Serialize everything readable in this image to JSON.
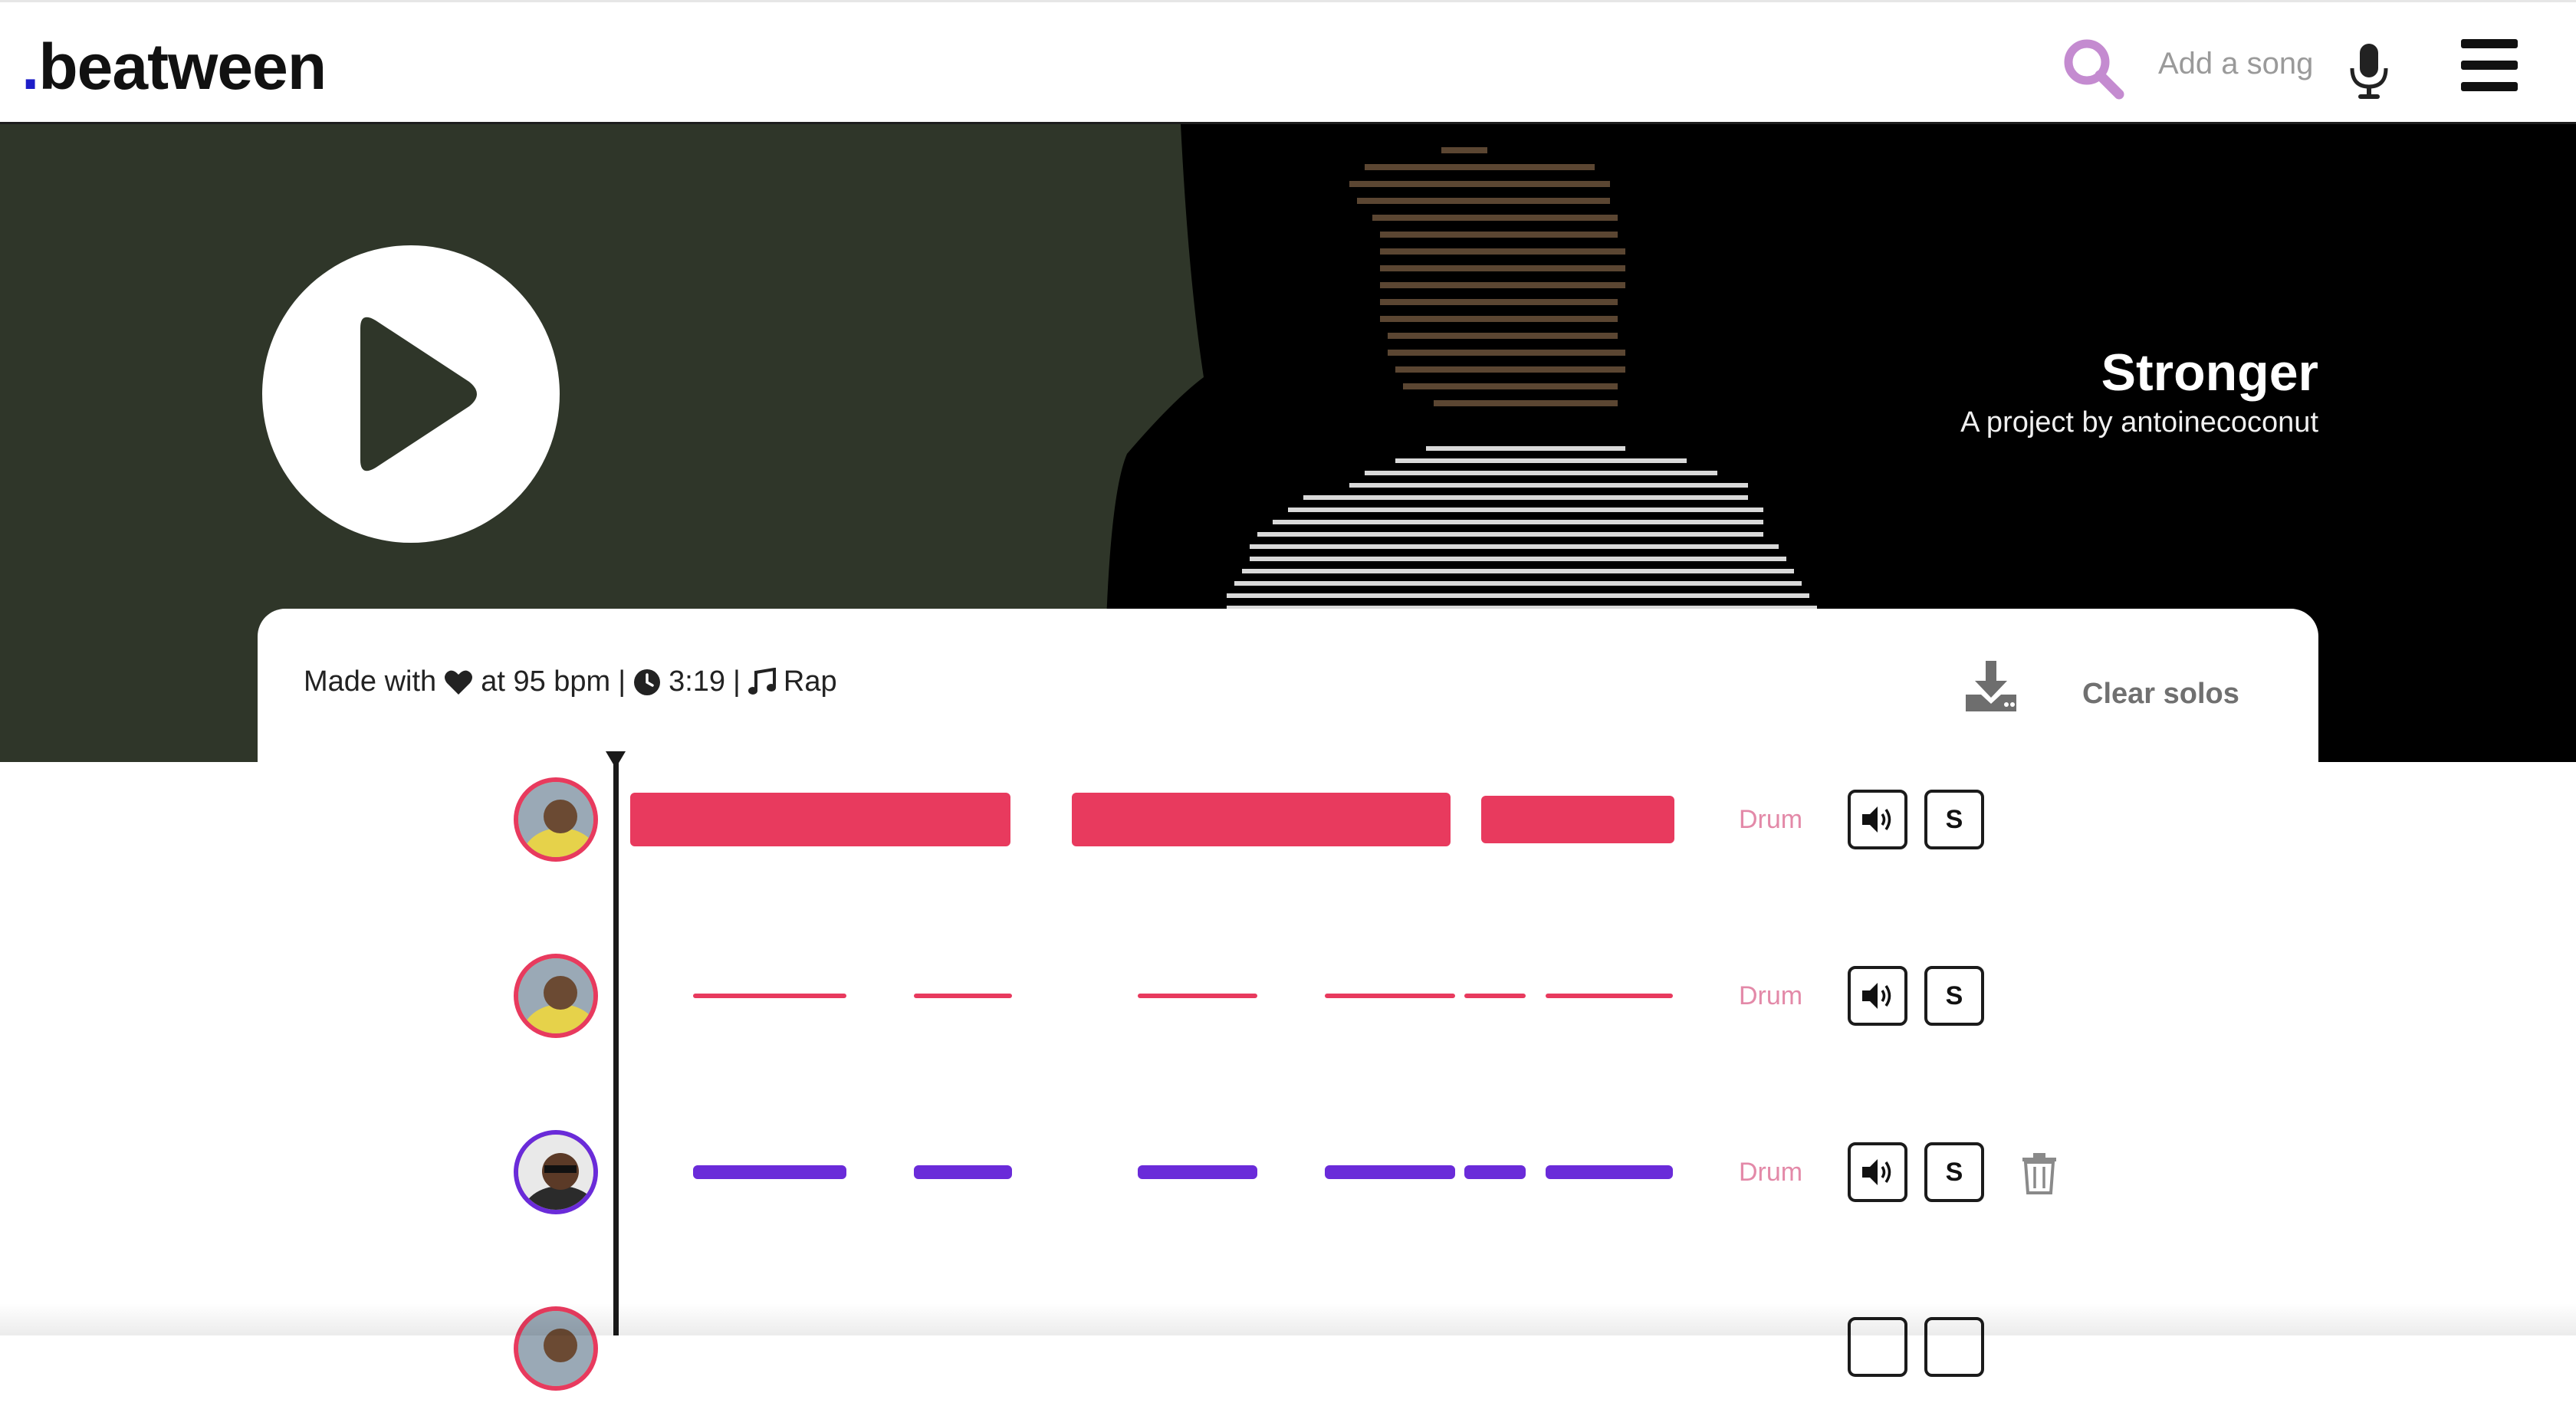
{
  "app": {
    "logo_dot": ".",
    "logo_text": "beatween",
    "accent": "#1d1dc8"
  },
  "nav": {
    "search_icon": "search-icon",
    "search_color": "#c48bd0",
    "add_song_label": "Add a song",
    "mic_icon": "microphone-icon",
    "menu_icon": "hamburger-menu-icon"
  },
  "hero": {
    "title": "Stronger",
    "subtitle": "A project by antoinecoconut",
    "left_color": "#2f3629",
    "play_icon": "play-icon"
  },
  "meta": {
    "made_with": "Made with",
    "heart_icon": "heart-icon",
    "bpm_text": "at 95 bpm",
    "sep1": "|",
    "clock_icon": "clock-icon",
    "duration": "3:19",
    "sep2": "|",
    "music_icon": "music-note-icon",
    "genre": "Rap"
  },
  "actions": {
    "download_icon": "download-icon",
    "clear_solos_label": "Clear solos"
  },
  "tracks": [
    {
      "instrument": "Drum",
      "wave_color": "#e83a5e",
      "avatar_border": "#e83a5e",
      "mute_icon": "speaker-icon",
      "solo_label": "S",
      "deletable": false
    },
    {
      "instrument": "Drum",
      "wave_color": "#e83a5e",
      "avatar_border": "#e83a5e",
      "mute_icon": "speaker-icon",
      "solo_label": "S",
      "deletable": false
    },
    {
      "instrument": "Drum",
      "wave_color": "#6a2bd9",
      "avatar_border": "#6a2bd9",
      "mute_icon": "speaker-icon",
      "solo_label": "S",
      "deletable": true
    },
    {
      "instrument": "",
      "wave_color": "#e83a5e",
      "avatar_border": "#e83a5e",
      "mute_icon": "speaker-icon",
      "solo_label": "",
      "deletable": false
    }
  ]
}
